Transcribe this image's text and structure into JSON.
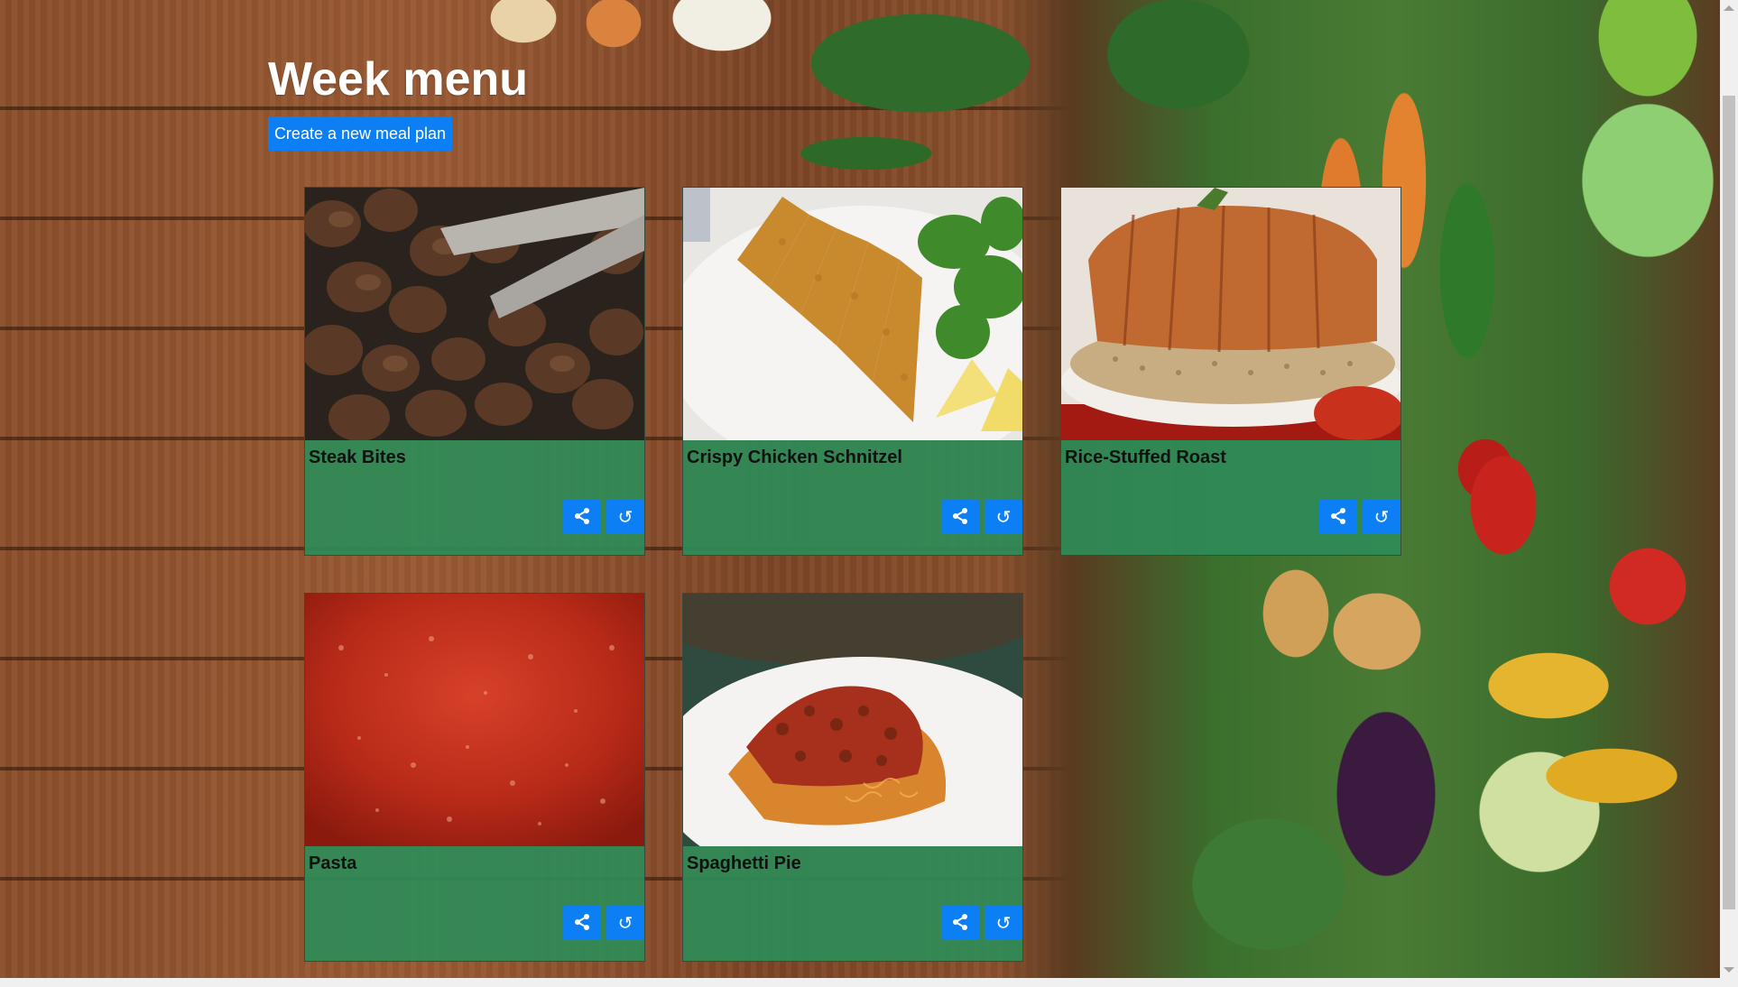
{
  "page": {
    "title": "Week menu",
    "create_button_label": "Create a new meal plan"
  },
  "theme": {
    "accent": "#0d7ff5",
    "card_background": "#2e8b57",
    "title_color": "#ffffff"
  },
  "meals": [
    {
      "name": "Steak Bites",
      "photo": "steak-bites-photo",
      "share_icon": "share-icon",
      "refresh_icon": "refresh-icon"
    },
    {
      "name": "Crispy Chicken Schnitzel",
      "photo": "chicken-schnitzel-photo",
      "share_icon": "share-icon",
      "refresh_icon": "refresh-icon"
    },
    {
      "name": "Rice-Stuffed Roast",
      "photo": "rice-stuffed-roast-photo",
      "share_icon": "share-icon",
      "refresh_icon": "refresh-icon"
    },
    {
      "name": "Pasta",
      "photo": "pasta-sauce-photo",
      "share_icon": "share-icon",
      "refresh_icon": "refresh-icon"
    },
    {
      "name": "Spaghetti Pie",
      "photo": "spaghetti-pie-photo",
      "share_icon": "share-icon",
      "refresh_icon": "refresh-icon"
    }
  ]
}
